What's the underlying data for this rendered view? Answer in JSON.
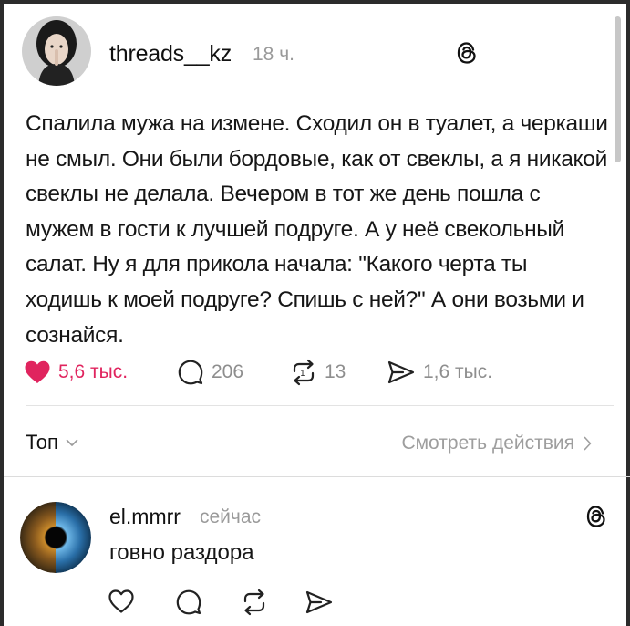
{
  "post": {
    "username": "threads__kz",
    "time": "18 ч.",
    "text": "Спалила мужа на измене. Сходил он в туалет, а черкаши не смыл. Они были бордовые, как от свеклы, а я никакой свеклы не делала. Вечером в тот же день пошла с мужем в гости к лучшей подруге. А у неё свекольный салат. Ну я для прикола начала: \"Какого черта ты ходишь к моей подруге? Спишь с ней?\" А они возьми и сознайся.",
    "likes": "5,6 тыс.",
    "comments": "206",
    "reposts": "13",
    "shares": "1,6 тыс.",
    "liked": true,
    "avatar_icon": "profile-photo"
  },
  "sort": {
    "label": "Топ",
    "icon": "chevron-down-icon"
  },
  "view_activity": {
    "label": "Смотреть действия",
    "icon": "chevron-right-icon"
  },
  "reply": {
    "username": "el.mmrr",
    "time": "сейчас",
    "text": "говно раздора",
    "avatar_icon": "eye-photo"
  },
  "colors": {
    "like_red": "#e0245e",
    "muted": "#8e8e8e",
    "text": "#161616"
  }
}
